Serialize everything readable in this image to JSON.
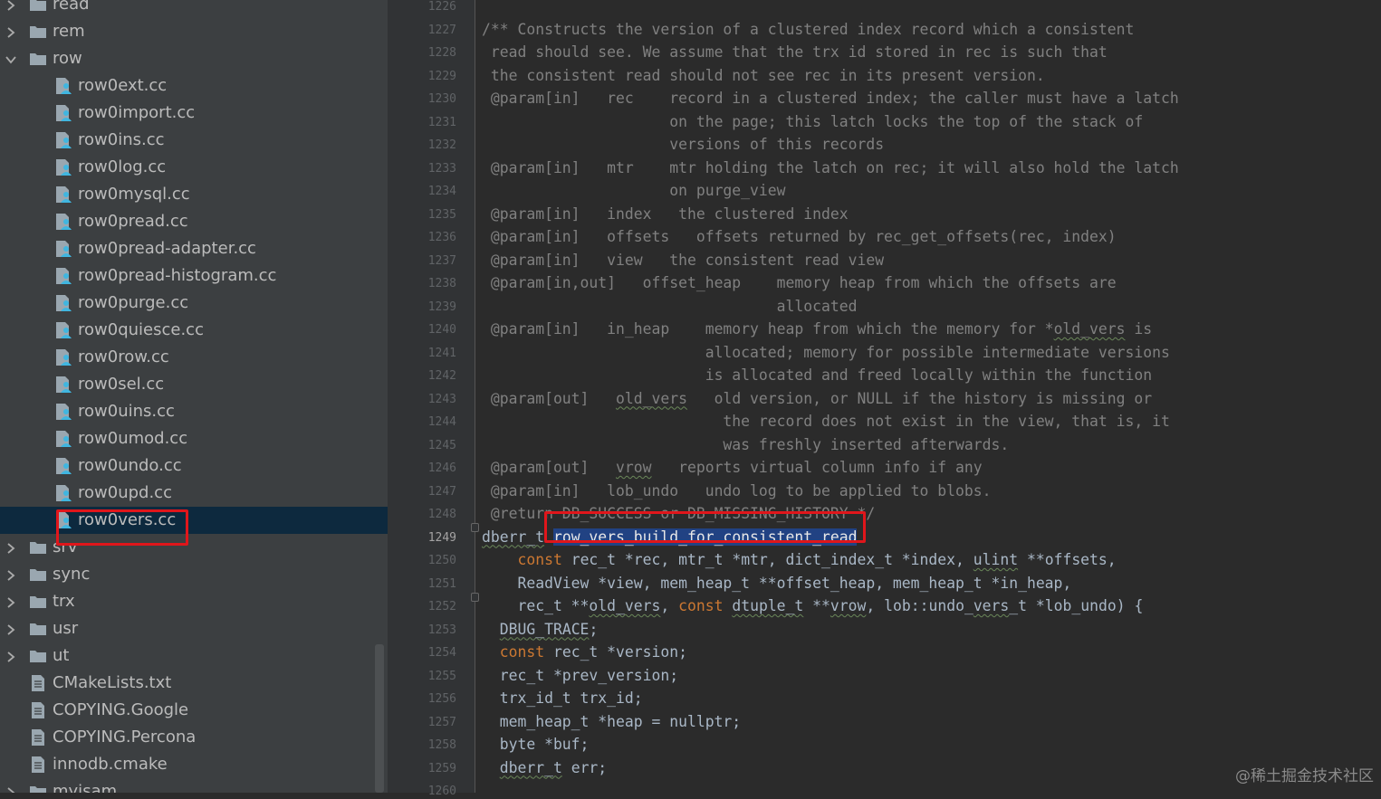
{
  "project_tree": {
    "items": [
      {
        "label": "read",
        "kind": "folder",
        "expanded": false,
        "indent": 0
      },
      {
        "label": "rem",
        "kind": "folder",
        "expanded": false,
        "indent": 0
      },
      {
        "label": "row",
        "kind": "folder",
        "expanded": true,
        "indent": 0
      },
      {
        "label": "row0ext.cc",
        "kind": "cc",
        "indent": 1
      },
      {
        "label": "row0import.cc",
        "kind": "cc",
        "indent": 1
      },
      {
        "label": "row0ins.cc",
        "kind": "cc",
        "indent": 1
      },
      {
        "label": "row0log.cc",
        "kind": "cc",
        "indent": 1
      },
      {
        "label": "row0mysql.cc",
        "kind": "cc",
        "indent": 1
      },
      {
        "label": "row0pread.cc",
        "kind": "cc",
        "indent": 1
      },
      {
        "label": "row0pread-adapter.cc",
        "kind": "cc",
        "indent": 1
      },
      {
        "label": "row0pread-histogram.cc",
        "kind": "cc",
        "indent": 1
      },
      {
        "label": "row0purge.cc",
        "kind": "cc",
        "indent": 1
      },
      {
        "label": "row0quiesce.cc",
        "kind": "cc",
        "indent": 1
      },
      {
        "label": "row0row.cc",
        "kind": "cc",
        "indent": 1
      },
      {
        "label": "row0sel.cc",
        "kind": "cc",
        "indent": 1
      },
      {
        "label": "row0uins.cc",
        "kind": "cc",
        "indent": 1
      },
      {
        "label": "row0umod.cc",
        "kind": "cc",
        "indent": 1
      },
      {
        "label": "row0undo.cc",
        "kind": "cc",
        "indent": 1
      },
      {
        "label": "row0upd.cc",
        "kind": "cc",
        "indent": 1
      },
      {
        "label": "row0vers.cc",
        "kind": "cc",
        "indent": 1,
        "selected": true
      },
      {
        "label": "srv",
        "kind": "folder",
        "expanded": false,
        "indent": 0
      },
      {
        "label": "sync",
        "kind": "folder",
        "expanded": false,
        "indent": 0
      },
      {
        "label": "trx",
        "kind": "folder",
        "expanded": false,
        "indent": 0
      },
      {
        "label": "usr",
        "kind": "folder",
        "expanded": false,
        "indent": 0
      },
      {
        "label": "ut",
        "kind": "folder",
        "expanded": false,
        "indent": 0
      },
      {
        "label": "CMakeLists.txt",
        "kind": "text",
        "indent": 0
      },
      {
        "label": "COPYING.Google",
        "kind": "text",
        "indent": 0
      },
      {
        "label": "COPYING.Percona",
        "kind": "text",
        "indent": 0
      },
      {
        "label": "innodb.cmake",
        "kind": "text",
        "indent": 0
      },
      {
        "label": "myisam",
        "kind": "folder",
        "expanded": false,
        "indent": 0,
        "partial": true
      }
    ]
  },
  "editor": {
    "current_line": 1249,
    "first_line": 1226,
    "lines": [
      [
        [
          "",
          "c"
        ]
      ],
      [
        [
          "/** Constructs the version of a clustered index record which a consistent",
          "c"
        ]
      ],
      [
        [
          " read should see. We assume that the trx id stored in rec is such that",
          "c"
        ]
      ],
      [
        [
          " the consistent read should not see rec in its present version.",
          "c"
        ]
      ],
      [
        [
          " @param[in]   rec    record in a clustered index; the caller must have a latch",
          "c"
        ]
      ],
      [
        [
          "                     on the page; this latch locks the top of the stack of",
          "c"
        ]
      ],
      [
        [
          "                     versions of this records",
          "c"
        ]
      ],
      [
        [
          " @param[in]   mtr    mtr holding the latch on rec; it will also hold the latch",
          "c"
        ]
      ],
      [
        [
          "                     on purge_view",
          "c"
        ]
      ],
      [
        [
          " @param[in]   index   the clustered index",
          "c"
        ]
      ],
      [
        [
          " @param[in]   offsets   offsets returned by rec_get_offsets(rec, index)",
          "c"
        ]
      ],
      [
        [
          " @param[in]   view   the consistent read view",
          "c"
        ]
      ],
      [
        [
          " @param[in,out]   offset_heap    memory heap from which the offsets are",
          "c"
        ]
      ],
      [
        [
          "                                 allocated",
          "c"
        ]
      ],
      [
        [
          " @param[in]   in_heap    memory heap from which the memory for *",
          "c"
        ],
        [
          "old_vers",
          "c sq"
        ],
        [
          " is",
          "c"
        ]
      ],
      [
        [
          "                         allocated; memory for possible intermediate versions",
          "c"
        ]
      ],
      [
        [
          "                         is allocated and freed locally within the function",
          "c"
        ]
      ],
      [
        [
          " @param[out]   ",
          "c"
        ],
        [
          "old_vers",
          "c sq"
        ],
        [
          "   old version, or NULL if the history is missing or",
          "c"
        ]
      ],
      [
        [
          "                           the record does not exist in the view, that is, it",
          "c"
        ]
      ],
      [
        [
          "                           was freshly inserted afterwards.",
          "c"
        ]
      ],
      [
        [
          " @param[out]   ",
          "c"
        ],
        [
          "vrow",
          "c sq"
        ],
        [
          "   reports virtual column info if any",
          "c"
        ]
      ],
      [
        [
          " @param[in]   lob_undo   undo log to be applied to blobs.",
          "c"
        ]
      ],
      [
        [
          " @return DB_SUCCESS or DB_MISSING_HISTORY */",
          "c"
        ]
      ],
      [
        [
          "dberr_t",
          "tv sq"
        ],
        [
          " ",
          ""
        ],
        [
          "row_vers_build_for_consistent_read",
          "hl"
        ]
      ],
      [
        [
          "    ",
          ""
        ],
        [
          "const",
          "kw"
        ],
        [
          " rec_t *rec, mtr_t *mtr, dict_index_t *index, ",
          ""
        ],
        [
          "ulint",
          "sq"
        ],
        [
          " **offsets,",
          ""
        ]
      ],
      [
        [
          "    ReadView *view, mem_heap_t **offset_heap, mem_heap_t *in_heap,",
          ""
        ]
      ],
      [
        [
          "    rec_t **",
          ""
        ],
        [
          "old_vers",
          "sq"
        ],
        [
          ", ",
          ""
        ],
        [
          "const",
          "kw"
        ],
        [
          " ",
          ""
        ],
        [
          "dtuple_t",
          "sq"
        ],
        [
          " **",
          ""
        ],
        [
          "vrow",
          "sq"
        ],
        [
          ", lob::undo_",
          ""
        ],
        [
          "vers",
          "sq"
        ],
        [
          "_t *lob_undo) {",
          ""
        ]
      ],
      [
        [
          "  ",
          ""
        ],
        [
          "DBUG_TRACE",
          "sq"
        ],
        [
          ";",
          ""
        ]
      ],
      [
        [
          "  ",
          ""
        ],
        [
          "const",
          "kw"
        ],
        [
          " rec_t *version;",
          ""
        ]
      ],
      [
        [
          "  rec_t *prev_version;",
          ""
        ]
      ],
      [
        [
          "  trx_id_t trx_id;",
          ""
        ]
      ],
      [
        [
          "  mem_heap_t *heap = nullptr;",
          ""
        ]
      ],
      [
        [
          "  byte *buf;",
          ""
        ]
      ],
      [
        [
          "  ",
          ""
        ],
        [
          "dberr_t",
          "sq"
        ],
        [
          " err;",
          ""
        ]
      ],
      [
        [
          "",
          ""
        ]
      ]
    ]
  },
  "watermark": "@稀土掘金技术社区",
  "colors": {
    "tree_bg": "#3c3f41",
    "editor_bg": "#2b2b2b",
    "selection": "#0d293e",
    "annotation_box": "#e0161b",
    "keyword": "#cc7832",
    "comment": "#808080"
  }
}
